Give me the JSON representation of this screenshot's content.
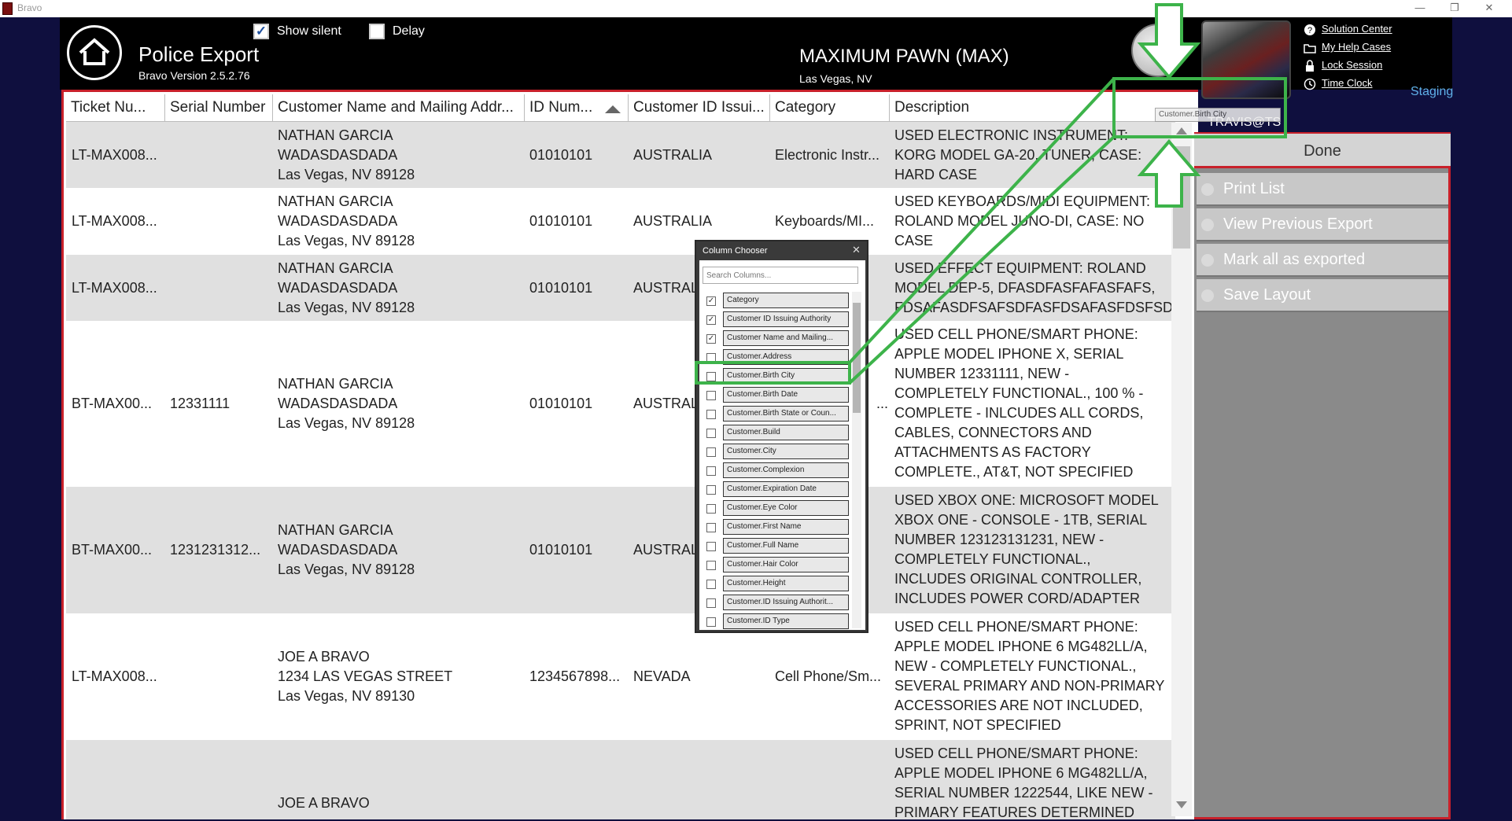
{
  "window": {
    "title": "Bravo",
    "minimize": "—",
    "restore": "❐",
    "close": "✕"
  },
  "header": {
    "title": "Police Export",
    "version": "Bravo Version 2.5.2.76",
    "show_silent": {
      "label": "Show silent",
      "checked": true
    },
    "delay": {
      "label": "Delay",
      "checked": false
    },
    "store_name": "MAXIMUM PAWN (MAX)",
    "store_location": "Las Vegas, NV",
    "user": "TRAVIS@TS",
    "environment": "Staging",
    "links": [
      "Solution Center",
      "My Help Cases",
      "Lock Session",
      "Time Clock"
    ]
  },
  "grid": {
    "columns": [
      "Ticket Nu...",
      "Serial Number",
      "Customer Name and Mailing Addr...",
      "ID Num...",
      "Customer ID Issui...",
      "Category",
      "Description"
    ],
    "rows": [
      {
        "ticket": "LT-MAX008...",
        "serial": "",
        "name": "NATHAN GARCIA",
        "addr1": "WADASDASDADA",
        "addr2": "Las Vegas, NV 89128",
        "id_num": "01010101",
        "issuer": "AUSTRALIA",
        "category": "Electronic Instr...",
        "description": "USED ELECTRONIC INSTRUMENT: KORG MODEL GA-20, TUNER, CASE: HARD CASE"
      },
      {
        "ticket": "LT-MAX008...",
        "serial": "",
        "name": "NATHAN GARCIA",
        "addr1": "WADASDASDADA",
        "addr2": "Las Vegas, NV 89128",
        "id_num": "01010101",
        "issuer": "AUSTRALIA",
        "category": "Keyboards/MI...",
        "description": "USED KEYBOARDS/MIDI EQUIPMENT: ROLAND MODEL JUNO-DI, CASE: NO CASE"
      },
      {
        "ticket": "LT-MAX008...",
        "serial": "",
        "name": "NATHAN GARCIA",
        "addr1": "WADASDASDADA",
        "addr2": "Las Vegas, NV 89128",
        "id_num": "01010101",
        "issuer": "AUSTRALIA",
        "category": "",
        "description": "USED EFFECT EQUIPMENT: ROLAND MODEL DEP-5, DFASDFASFAFASFAFS, FDSAFASDFSAFSDFASFDSAFASFDSFSD"
      },
      {
        "ticket": "BT-MAX00...",
        "serial": "12331111",
        "name": "NATHAN GARCIA",
        "addr1": "WADASDASDADA",
        "addr2": "Las Vegas, NV 89128",
        "id_num": "01010101",
        "issuer": "AUSTRALIA",
        "category": "",
        "description": "USED CELL PHONE/SMART PHONE: APPLE MODEL IPHONE X, SERIAL NUMBER 12331111, NEW - COMPLETELY FUNCTIONAL., 100 % - COMPLETE - INLCUDES ALL CORDS, CABLES, CONNECTORS AND ATTACHMENTS AS FACTORY COMPLETE., AT&T, NOT SPECIFIED"
      },
      {
        "ticket": "BT-MAX00...",
        "serial": "1231231312...",
        "name": "NATHAN GARCIA",
        "addr1": "WADASDASDADA",
        "addr2": "Las Vegas, NV 89128",
        "id_num": "01010101",
        "issuer": "AUSTRALIA",
        "category": "",
        "description": "USED XBOX ONE: MICROSOFT MODEL XBOX ONE - CONSOLE - 1TB, SERIAL NUMBER 123123131231, NEW - COMPLETELY FUNCTIONAL., INCLUDES ORIGINAL CONTROLLER, INCLUDES POWER CORD/ADAPTER"
      },
      {
        "ticket": "LT-MAX008...",
        "serial": "",
        "name": "JOE A BRAVO",
        "addr1": "1234 LAS VEGAS STREET",
        "addr2": "Las Vegas, NV 89130",
        "id_num": "1234567898...",
        "issuer": "NEVADA",
        "category": "Cell Phone/Sm...",
        "description": "USED CELL PHONE/SMART PHONE: APPLE MODEL IPHONE 6 MG482LL/A, NEW - COMPLETELY FUNCTIONAL., SEVERAL PRIMARY AND NON-PRIMARY ACCESSORIES ARE NOT INCLUDED, SPRINT, NOT SPECIFIED"
      },
      {
        "ticket": "",
        "serial": "",
        "name": "JOE A BRAVO",
        "addr1": "",
        "addr2": "",
        "id_num": "",
        "issuer": "",
        "category": "",
        "description": "USED CELL PHONE/SMART PHONE: APPLE MODEL IPHONE 6 MG482LL/A, SERIAL NUMBER 1222544, LIKE NEW - PRIMARY FEATURES DETERMINED"
      }
    ],
    "row_ellipsis": "..."
  },
  "actions": {
    "done": "Done",
    "menu": [
      "Print List",
      "View Previous Export",
      "Mark all as exported",
      "Save Layout"
    ]
  },
  "column_chooser": {
    "title": "Column Chooser",
    "close": "✕",
    "search_placeholder": "Search Columns...",
    "items": [
      {
        "label": "Category",
        "checked": true
      },
      {
        "label": "Customer ID Issuing Authority",
        "checked": true
      },
      {
        "label": "Customer Name and Mailing...",
        "checked": true
      },
      {
        "label": "Customer.Address",
        "checked": false
      },
      {
        "label": "Customer.Birth City",
        "checked": false
      },
      {
        "label": "Customer.Birth Date",
        "checked": false
      },
      {
        "label": "Customer.Birth State or Coun...",
        "checked": false
      },
      {
        "label": "Customer.Build",
        "checked": false
      },
      {
        "label": "Customer.City",
        "checked": false
      },
      {
        "label": "Customer.Complexion",
        "checked": false
      },
      {
        "label": "Customer.Expiration Date",
        "checked": false
      },
      {
        "label": "Customer.Eye Color",
        "checked": false
      },
      {
        "label": "Customer.First Name",
        "checked": false
      },
      {
        "label": "Customer.Full Name",
        "checked": false
      },
      {
        "label": "Customer.Hair Color",
        "checked": false
      },
      {
        "label": "Customer.Height",
        "checked": false
      },
      {
        "label": "Customer.ID Issuing Authorit...",
        "checked": false
      },
      {
        "label": "Customer.ID Type",
        "checked": false
      }
    ],
    "drag_ghost": "Customer.Birth City"
  },
  "colors": {
    "accent_red": "#c8202a",
    "annotation_green": "#3db34a",
    "panel_gray": "#8a8a8a",
    "row_alt": "#e0e0e0"
  }
}
